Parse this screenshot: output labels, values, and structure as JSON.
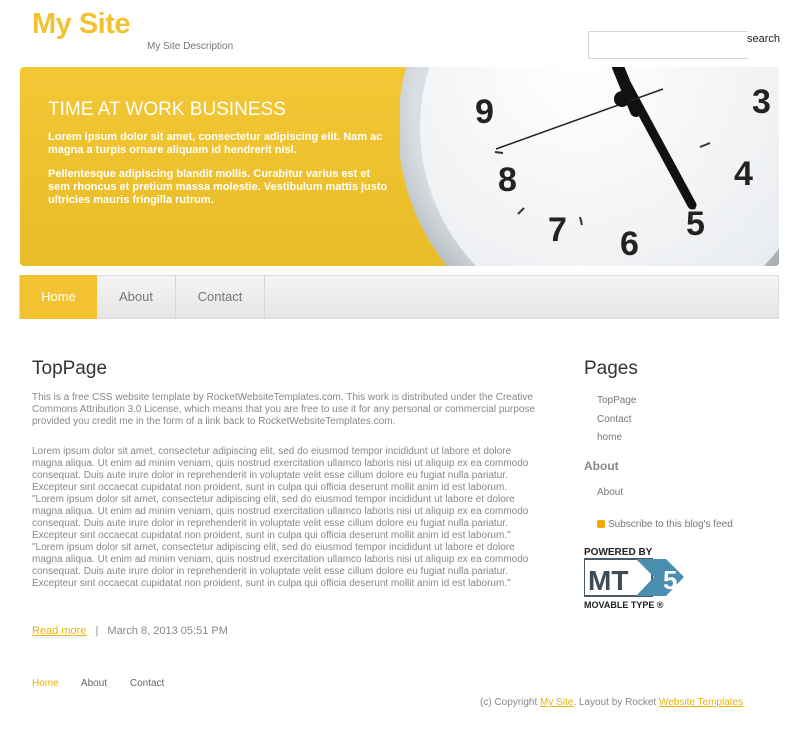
{
  "header": {
    "site_title": "My Site",
    "site_description": "My Site Description",
    "search_label": "search",
    "search_placeholder": ""
  },
  "banner": {
    "title": "TIME AT WORK BUSINESS",
    "paragraphs": [
      "Lorem ipsum dolor sit amet, consectetur adipiscing elit. Nam ac magna a turpis ornare aliquam id hendrerit nisl.",
      "Pellentesque adipiscing blandit mollis. Curabitur varius est et sem rhoncus et pretium massa molestie. Vestibulum mattis justo ultricies mauris fringilla rutrum."
    ],
    "clock_numbers": [
      "9",
      "3",
      "8",
      "4",
      "7",
      "6",
      "5"
    ],
    "colors": {
      "background": "#f2c42a"
    }
  },
  "nav": {
    "items": [
      {
        "label": "Home",
        "active": true
      },
      {
        "label": "About",
        "active": false
      },
      {
        "label": "Contact",
        "active": false
      }
    ]
  },
  "post": {
    "title": "TopPage",
    "intro": "This is a free CSS website template by RocketWebsiteTemplates.com. This work is distributed under the Creative Commons Attribution 3.0 License, which means that you are free to use it for any personal or commercial purpose provided you credit me in the form of a link back to RocketWebsiteTemplates.com.",
    "body": "Lorem ipsum dolor sit amet, consectetur adipiscing elit, sed do eiusmod tempor incididunt ut labore et dolore magna aliqua. Ut enim ad minim veniam, quis nostrud exercitation ullamco laboris nisi ut aliquip ex ea commodo consequat. Duis aute irure dolor in reprehenderit in voluptate velit esse cillum dolore eu fugiat nulla pariatur. Excepteur sint occaecat cupidatat non proident, sunt in culpa qui officia deserunt mollit anim id est laborum. \"Lorem ipsum dolor sit amet, consectetur adipiscing elit, sed do eiusmod tempor incididunt ut labore et dolore magna aliqua. Ut enim ad minim veniam, quis nostrud exercitation ullamco laboris nisi ut aliquip ex ea commodo consequat. Duis aute irure dolor in reprehenderit in voluptate velit esse cillum dolore eu fugiat nulla pariatur. Excepteur sint occaecat cupidatat non proident, sunt in culpa qui officia deserunt mollit anim id est laborum.\" \"Lorem ipsum dolor sit amet, consectetur adipiscing elit, sed do eiusmod tempor incididunt ut labore et dolore magna aliqua. Ut enim ad minim veniam, quis nostrud exercitation ullamco laboris nisi ut aliquip ex ea commodo consequat. Duis aute irure dolor in reprehenderit in voluptate velit esse cillum dolore eu fugiat nulla pariatur. Excepteur sint occaecat cupidatat non proident, sunt in culpa qui officia deserunt mollit anim id est laborum.\"",
    "read_more": "Read more",
    "separator": "|",
    "date": "March 8, 2013 05:51 PM"
  },
  "sidebar": {
    "pages_title": "Pages",
    "pages": [
      {
        "label": "TopPage"
      },
      {
        "label": "Contact"
      },
      {
        "label": "home"
      }
    ],
    "about_title": "About",
    "about_items": [
      {
        "label": "About"
      }
    ],
    "feed_label": "Subscribe to this blog's feed",
    "powered_logo": {
      "top": "POWERED BY",
      "mark": "MT",
      "version": "5",
      "bottom": "MOVABLE TYPE ®"
    }
  },
  "footer": {
    "nav": [
      {
        "label": "Home",
        "active": true
      },
      {
        "label": "About",
        "active": false
      },
      {
        "label": "Contact",
        "active": false
      }
    ],
    "copyright_prefix": "(c) Copyright",
    "copyright_site": "My Site",
    "copyright_middle": ". Layout by Rocket",
    "copyright_link": "Website Templates"
  },
  "colors": {
    "accent": "#f2c230",
    "link": "#e8b400"
  }
}
